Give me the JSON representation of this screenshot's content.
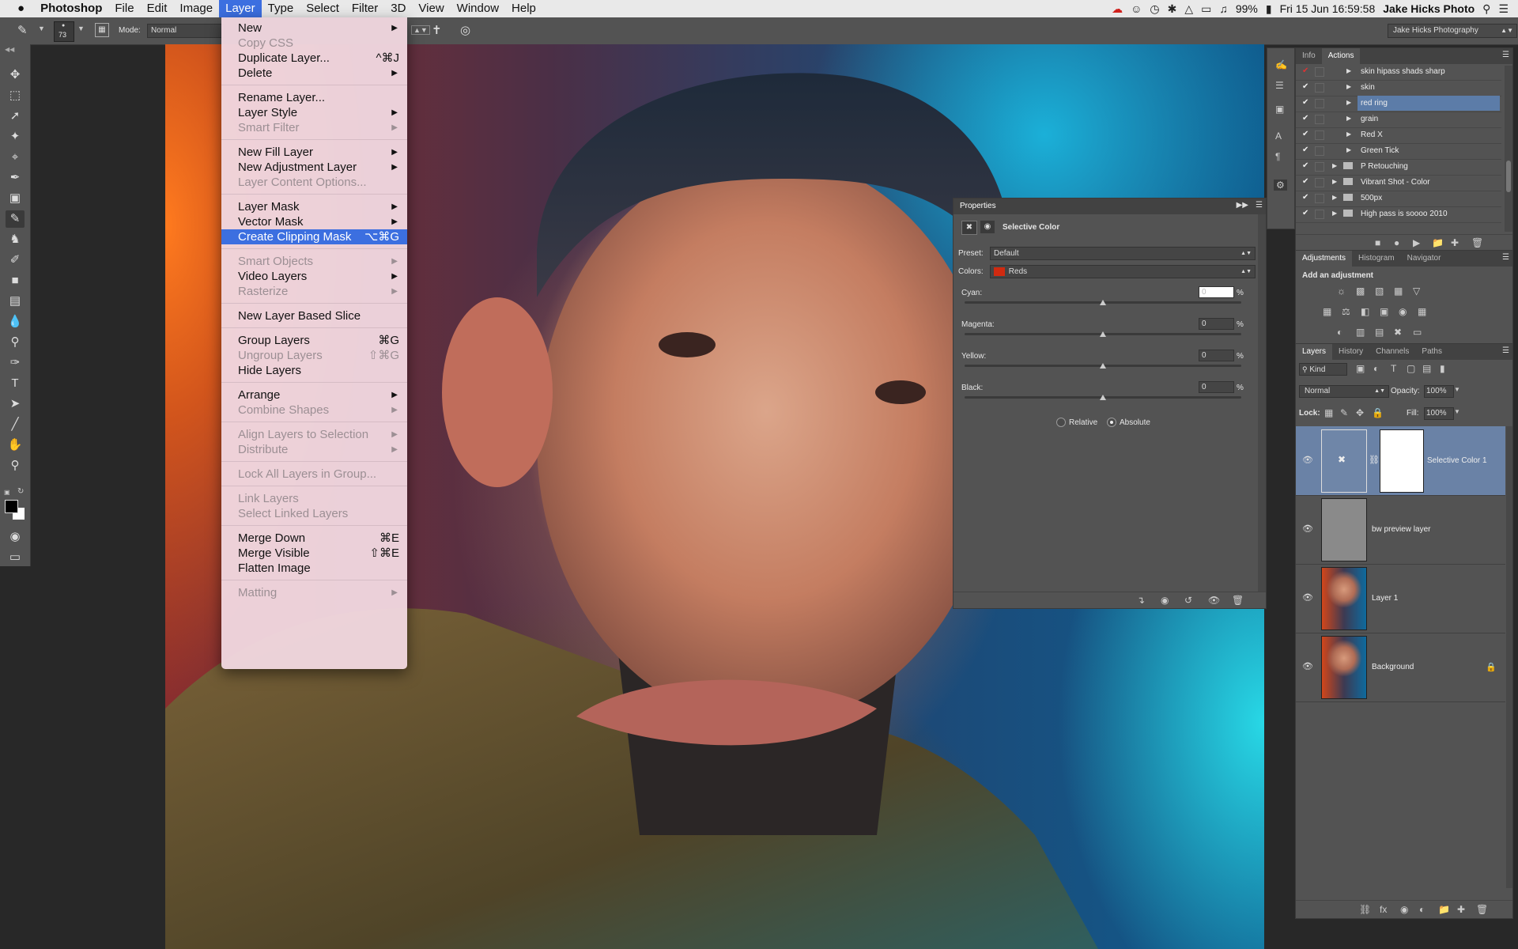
{
  "menubar": {
    "apple": "",
    "app": "Photoshop",
    "items": [
      "File",
      "Edit",
      "Image",
      "Layer",
      "Type",
      "Select",
      "Filter",
      "3D",
      "View",
      "Window",
      "Help"
    ],
    "active": "Layer",
    "battery": "99%",
    "datetime": "Fri 15 Jun  16:59:58",
    "user": "Jake Hicks Photo"
  },
  "optionsbar": {
    "brush_size": "73",
    "mode_label": "Mode:",
    "mode_value": "Normal",
    "workspace": "Jake Hicks Photography"
  },
  "layer_menu": [
    {
      "label": "New",
      "arrow": true
    },
    {
      "label": "Copy CSS",
      "disabled": true
    },
    {
      "label": "Duplicate Layer...",
      "shortcut": "^⌘J"
    },
    {
      "label": "Delete",
      "arrow": true
    },
    {
      "sep": true
    },
    {
      "label": "Rename Layer..."
    },
    {
      "label": "Layer Style",
      "arrow": true
    },
    {
      "label": "Smart Filter",
      "arrow": true,
      "disabled": true
    },
    {
      "sep": true
    },
    {
      "label": "New Fill Layer",
      "arrow": true
    },
    {
      "label": "New Adjustment Layer",
      "arrow": true
    },
    {
      "label": "Layer Content Options...",
      "disabled": true
    },
    {
      "sep": true
    },
    {
      "label": "Layer Mask",
      "arrow": true
    },
    {
      "label": "Vector Mask",
      "arrow": true
    },
    {
      "label": "Create Clipping Mask",
      "shortcut": "⌥⌘G",
      "highlight": true
    },
    {
      "sep": true
    },
    {
      "label": "Smart Objects",
      "arrow": true,
      "disabled": true
    },
    {
      "label": "Video Layers",
      "arrow": true
    },
    {
      "label": "Rasterize",
      "arrow": true,
      "disabled": true
    },
    {
      "sep": true
    },
    {
      "label": "New Layer Based Slice"
    },
    {
      "sep": true
    },
    {
      "label": "Group Layers",
      "shortcut": "⌘G"
    },
    {
      "label": "Ungroup Layers",
      "shortcut": "⇧⌘G",
      "disabled": true
    },
    {
      "label": "Hide Layers"
    },
    {
      "sep": true
    },
    {
      "label": "Arrange",
      "arrow": true
    },
    {
      "label": "Combine Shapes",
      "arrow": true,
      "disabled": true
    },
    {
      "sep": true
    },
    {
      "label": "Align Layers to Selection",
      "arrow": true,
      "disabled": true
    },
    {
      "label": "Distribute",
      "arrow": true,
      "disabled": true
    },
    {
      "sep": true
    },
    {
      "label": "Lock All Layers in Group...",
      "disabled": true
    },
    {
      "sep": true
    },
    {
      "label": "Link Layers",
      "disabled": true
    },
    {
      "label": "Select Linked Layers",
      "disabled": true
    },
    {
      "sep": true
    },
    {
      "label": "Merge Down",
      "shortcut": "⌘E"
    },
    {
      "label": "Merge Visible",
      "shortcut": "⇧⌘E"
    },
    {
      "label": "Flatten Image"
    },
    {
      "sep": true
    },
    {
      "label": "Matting",
      "arrow": true,
      "disabled": true
    }
  ],
  "properties": {
    "title": "Properties",
    "adjustment": "Selective Color",
    "preset_label": "Preset:",
    "preset_value": "Default",
    "colors_label": "Colors:",
    "colors_value": "Reds",
    "colors_swatch": "#d02a10",
    "sliders": [
      {
        "label": "Cyan:",
        "value": "0"
      },
      {
        "label": "Magenta:",
        "value": "0"
      },
      {
        "label": "Yellow:",
        "value": "0"
      },
      {
        "label": "Black:",
        "value": "0"
      }
    ],
    "pct": "%",
    "relative": "Relative",
    "absolute": "Absolute",
    "method_selected": "Absolute"
  },
  "actions_panel": {
    "tabs": [
      "Info",
      "Actions"
    ],
    "active_tab": "Actions",
    "items": [
      {
        "name": "skin hipass shads sharp",
        "indent": 2
      },
      {
        "name": "skin",
        "indent": 2
      },
      {
        "name": "red ring",
        "indent": 2,
        "highlight": true
      },
      {
        "name": "grain",
        "indent": 2
      },
      {
        "name": "Red X",
        "indent": 2
      },
      {
        "name": "Green Tick",
        "indent": 2
      },
      {
        "name": "P Retouching",
        "indent": 1,
        "folder": true
      },
      {
        "name": "Vibrant Shot - Color",
        "indent": 1,
        "folder": true
      },
      {
        "name": "500px",
        "indent": 1,
        "folder": true
      },
      {
        "name": "High pass is soooo 2010",
        "indent": 1,
        "folder": true
      }
    ]
  },
  "adjustments_panel": {
    "tabs": [
      "Adjustments",
      "Histogram",
      "Navigator"
    ],
    "active_tab": "Adjustments",
    "title": "Add an adjustment"
  },
  "layers_panel": {
    "tabs": [
      "Layers",
      "History",
      "Channels",
      "Paths"
    ],
    "active_tab": "Layers",
    "kind": "Kind",
    "blend": "Normal",
    "opacity_label": "Opacity:",
    "opacity": "100%",
    "lock_label": "Lock:",
    "fill_label": "Fill:",
    "fill": "100%",
    "layers": [
      {
        "name": "Selective Color 1",
        "type": "adjustment",
        "highlight": true
      },
      {
        "name": "bw preview layer",
        "type": "gray"
      },
      {
        "name": "Layer 1",
        "type": "photo"
      },
      {
        "name": "Background",
        "type": "photo",
        "locked": true
      }
    ]
  }
}
